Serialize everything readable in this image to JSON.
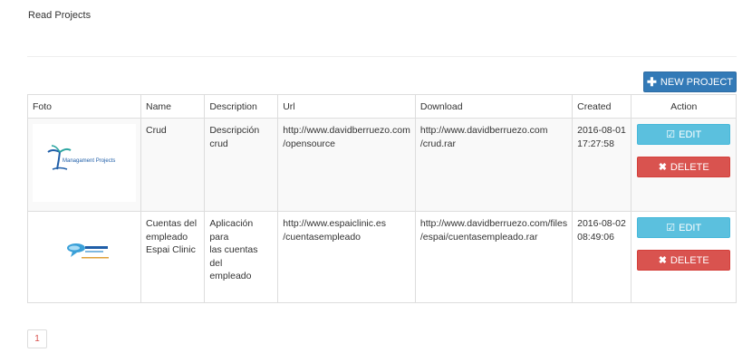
{
  "page": {
    "title": "Read Projects"
  },
  "toolbar": {
    "new_project_label": "NEW PROJECT"
  },
  "table": {
    "headers": [
      "Foto",
      "Name",
      "Description",
      "Url",
      "Download",
      "Created",
      "Action"
    ],
    "rows": [
      {
        "logo": "managament-projects-logo",
        "logo_text": "Managament Projects",
        "name": "Crud",
        "description": "Descripción crud",
        "url_line1": "http://www.davidberruezo.com",
        "url_line2": "/opensource",
        "download_line1": "http://www.davidberruezo.com",
        "download_line2": "/crud.rar",
        "created_date": "2016-08-01",
        "created_time": "17:27:58",
        "edit_label": "EDIT",
        "delete_label": "DELETE"
      },
      {
        "logo": "espai-clinic-logo",
        "name_line1": "Cuentas del",
        "name_line2": "empleado",
        "name_line3": "Espai Clinic",
        "description_line1": "Aplicación para",
        "description_line2": "las cuentas del",
        "description_line3": "empleado",
        "url_line1": "http://www.espaiclinic.es",
        "url_line2": "/cuentasempleado",
        "download_line1": "http://www.davidberruezo.com/files",
        "download_line2": "/espai/cuentasempleado.rar",
        "created_date": "2016-08-02",
        "created_time": "08:49:06",
        "edit_label": "EDIT",
        "delete_label": "DELETE"
      }
    ]
  },
  "pagination": {
    "current_page": "1"
  },
  "colors": {
    "primary": "#337ab7",
    "info": "#5bc0de",
    "danger": "#d9534f"
  }
}
